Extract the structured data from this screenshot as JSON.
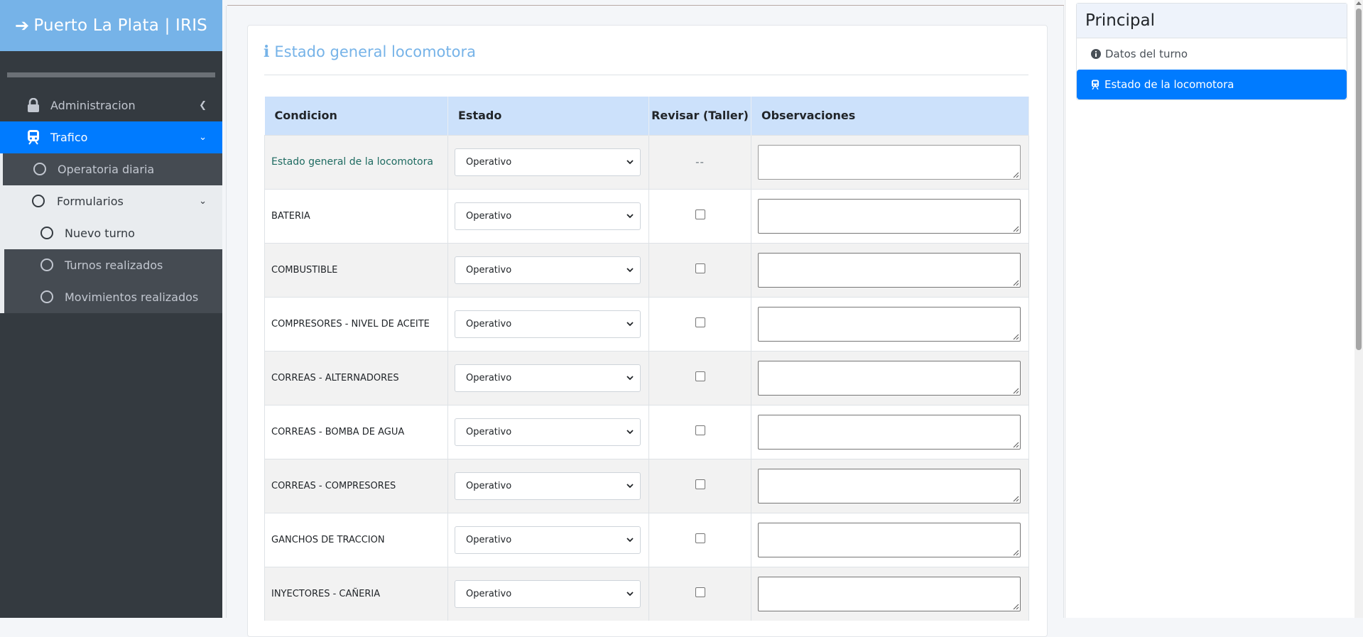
{
  "brand": {
    "title": "Puerto La Plata | IRIS"
  },
  "sidebar": {
    "items": [
      {
        "label": "Administracion"
      },
      {
        "label": "Trafico"
      }
    ],
    "sub": [
      {
        "label": "Operatoria diaria"
      },
      {
        "label": "Formularios"
      }
    ],
    "forms": [
      {
        "label": "Nuevo turno"
      },
      {
        "label": "Turnos realizados"
      },
      {
        "label": "Movimientos realizados"
      }
    ]
  },
  "card": {
    "title": "Estado general locomotora",
    "columns": [
      "Condicion",
      "Estado",
      "Revisar (Taller)",
      "Observaciones"
    ],
    "rows": [
      {
        "condition": "Estado general de la locomotora",
        "estado": "Operativo",
        "revisar": "--",
        "observaciones": ""
      },
      {
        "condition": "BATERIA",
        "estado": "Operativo",
        "revisar": false,
        "observaciones": ""
      },
      {
        "condition": "COMBUSTIBLE",
        "estado": "Operativo",
        "revisar": false,
        "observaciones": ""
      },
      {
        "condition": "COMPRESORES - NIVEL DE ACEITE",
        "estado": "Operativo",
        "revisar": false,
        "observaciones": ""
      },
      {
        "condition": "CORREAS - ALTERNADORES",
        "estado": "Operativo",
        "revisar": false,
        "observaciones": ""
      },
      {
        "condition": "CORREAS - BOMBA DE AGUA",
        "estado": "Operativo",
        "revisar": false,
        "observaciones": ""
      },
      {
        "condition": "CORREAS - COMPRESORES",
        "estado": "Operativo",
        "revisar": false,
        "observaciones": ""
      },
      {
        "condition": "GANCHOS DE TRACCION",
        "estado": "Operativo",
        "revisar": false,
        "observaciones": ""
      },
      {
        "condition": "INYECTORES - CAÑERIA",
        "estado": "Operativo",
        "revisar": false,
        "observaciones": ""
      }
    ]
  },
  "panel": {
    "title": "Principal",
    "items": [
      {
        "label": "Datos del turno",
        "icon": "info-circle-icon"
      },
      {
        "label": "Estado de la locomotora",
        "icon": "train-icon"
      }
    ]
  },
  "colors": {
    "brand": "#76b3e8",
    "sidebar": "#343a40",
    "active": "#007bff",
    "header_row": "#cce1fb"
  }
}
